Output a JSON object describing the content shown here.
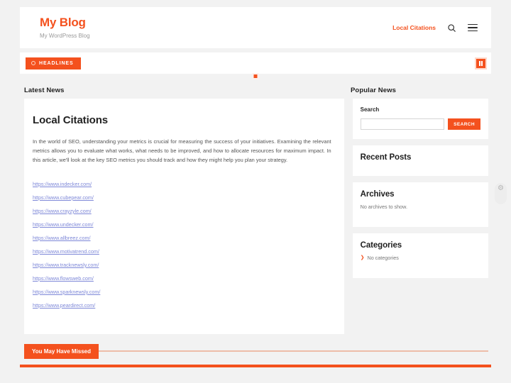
{
  "header": {
    "brand_title": "My Blog",
    "tagline": "My WordPress Blog",
    "nav_link": "Local Citations",
    "search_icon": "search-icon",
    "menu_icon": "hamburger-menu-icon"
  },
  "ticker": {
    "badge_label": "HEADLINES",
    "badge_icon": "clock-icon",
    "control_icon": "pause-icon",
    "loader_icon": "loading-square-icon"
  },
  "sections": {
    "main_heading": "Latest News",
    "sidebar_heading": "Popular News"
  },
  "article": {
    "title": "Local Citations",
    "body": "In the world of SEO, understanding your metrics is crucial for measuring the success of your initiatives. Examining the relevant metrics allows you to evaluate what works, what needs to be improved, and how to allocate resources for maximum impact. In this article, we'll look at the key SEO metrics you should track and how they might help you plan your strategy.",
    "links": [
      "https://www.indecker.com/",
      "https://www.cubepear.com/",
      "https://www.crayzyle.com/",
      "https://www.undecker.com/",
      "https://www.allbreez.com/",
      "https://www.motivatrend.com/",
      "https://www.tracknewsly.com/",
      "https://www.flowsweb.com/",
      "https://www.sparknewsly.com/",
      "https://www.peardirect.com/"
    ]
  },
  "sidebar": {
    "search": {
      "label": "Search",
      "value": "",
      "placeholder": "",
      "button_label": "SEARCH"
    },
    "recent_posts": {
      "title": "Recent Posts"
    },
    "archives": {
      "title": "Archives",
      "empty_text": "No archives to show."
    },
    "categories": {
      "title": "Categories",
      "empty_text": "No categories",
      "bullet_icon": "chevron-right-icon"
    }
  },
  "missed": {
    "label": "You May Have Missed"
  },
  "floating": {
    "gear_icon": "gear-icon"
  },
  "colors": {
    "accent": "#f4511e",
    "link": "#7e88d8",
    "page_bg": "#f2f2f2",
    "card_bg": "#ffffff"
  }
}
